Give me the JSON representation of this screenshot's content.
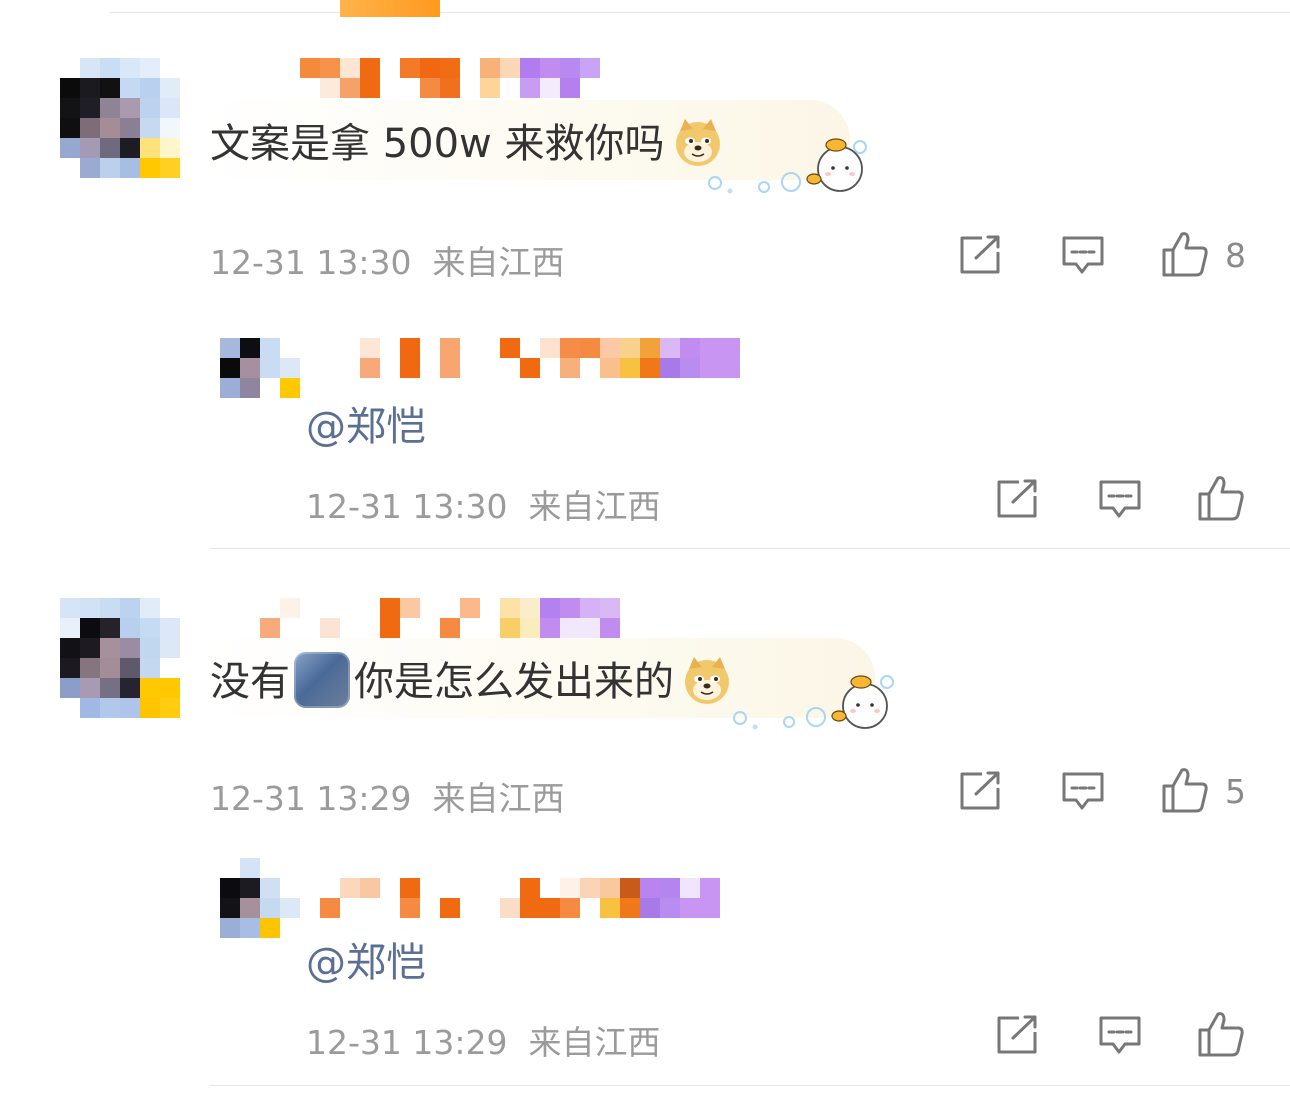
{
  "comments": [
    {
      "text_before": "文案是拿 500w 来救你吗",
      "emoji": "doge-emoji",
      "timestamp": "12-31 13:30",
      "location": "来自江西",
      "like_count": "8",
      "reply": {
        "mention": "@郑恺",
        "timestamp": "12-31 13:30",
        "location": "来自江西"
      }
    },
    {
      "text_before": "没有",
      "text_after": "你是怎么发出来的",
      "emoji": "doge-emoji",
      "timestamp": "12-31 13:29",
      "location": "来自江西",
      "like_count": "5",
      "reply": {
        "mention": "@郑恺",
        "timestamp": "12-31 13:29",
        "location": "来自江西"
      }
    }
  ],
  "icons": {
    "share": "share-icon",
    "comment": "comment-icon",
    "like": "thumbs-up-icon"
  },
  "colors": {
    "mention": "#5b6f95",
    "meta": "#9b9b9b",
    "name_orange": "#f08a3c",
    "name_purple": "#c08cf0"
  }
}
